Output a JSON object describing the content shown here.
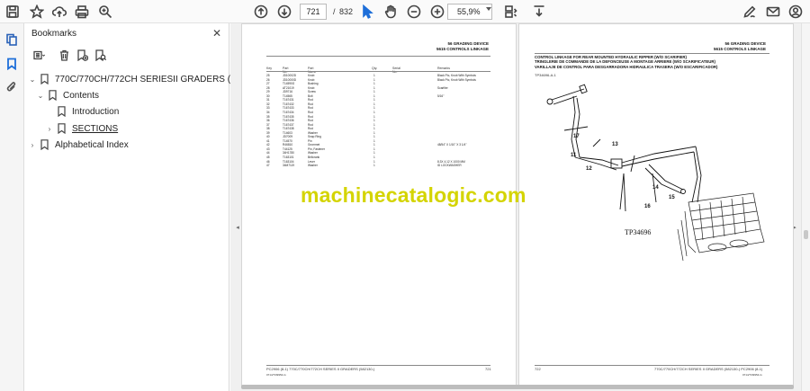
{
  "toolbar": {
    "page_current": "721",
    "page_separator": "/",
    "page_total": "832",
    "zoom": "55,9%"
  },
  "panel": {
    "title": "Bookmarks",
    "close_glyph": "✕"
  },
  "bookmarks": [
    {
      "label": "770C/770CH/772CH SERIESII GRADERS (582130-)",
      "chevron": "⌄"
    },
    {
      "label": "Contents",
      "chevron": "⌄"
    },
    {
      "label": "Introduction",
      "chevron": ""
    },
    {
      "label": "SECTIONS",
      "chevron": "›"
    },
    {
      "label": "Alphabetical Index",
      "chevron": "›"
    }
  ],
  "collapse": {
    "left": "◂",
    "right": "▸"
  },
  "watermark": "machinecatalogic.com",
  "left_page": {
    "header_line1": "56 GRADING DEVICE",
    "header_line2": "5615 CONTROLS LINKAGE",
    "footer_left": "PC2906   (8-1)     770C/770CH/772CH SERIES II GRADERS (582130-)",
    "footer_page": "721",
    "footer_code": "0714/7/09954-G",
    "rows": [
      {
        "no": "25",
        "part": "JD10002D",
        "desc": "Knob",
        "qty": "1",
        "notes": "Black Ptc, Knob With Symbols"
      },
      {
        "no": "26",
        "part": "JD10000D",
        "desc": "Knob",
        "qty": "1",
        "notes": "Black Ptc, Knob With Symbols"
      },
      {
        "no": "27",
        "part": "T14590G",
        "desc": "Bushing",
        "qty": "1",
        "notes": ""
      },
      {
        "no": "28",
        "part": "AT21019",
        "desc": "Knob",
        "qty": "1",
        "notes": "Scarifier"
      },
      {
        "no": "29",
        "part": "JD9716",
        "desc": "Screw",
        "qty": "1",
        "notes": ""
      },
      {
        "no": "30",
        "part": "T14565",
        "desc": "Bolt",
        "qty": "1",
        "notes": "5/16\""
      },
      {
        "no": "31",
        "part": "T167431",
        "desc": "Rod",
        "qty": "1",
        "notes": ""
      },
      {
        "no": "32",
        "part": "T167432",
        "desc": "Rod",
        "qty": "1",
        "notes": ""
      },
      {
        "no": "33",
        "part": "T167433",
        "desc": "Rod",
        "qty": "1",
        "notes": ""
      },
      {
        "no": "34",
        "part": "T167434",
        "desc": "Rod",
        "qty": "1",
        "notes": ""
      },
      {
        "no": "35",
        "part": "T167435",
        "desc": "Rod",
        "qty": "1",
        "notes": ""
      },
      {
        "no": "36",
        "part": "T167436",
        "desc": "Rod",
        "qty": "1",
        "notes": ""
      },
      {
        "no": "37",
        "part": "T167437",
        "desc": "Rod",
        "qty": "1",
        "notes": ""
      },
      {
        "no": "38",
        "part": "T167438",
        "desc": "Rod",
        "qty": "1",
        "notes": ""
      },
      {
        "no": "39",
        "part": "T14603",
        "desc": "Washer",
        "qty": "1",
        "notes": ""
      },
      {
        "no": "40",
        "part": "JD7009",
        "desc": "Snap Ring",
        "qty": "1",
        "notes": ""
      },
      {
        "no": "41",
        "part": "T14570",
        "desc": "Pin",
        "qty": "1",
        "notes": ""
      },
      {
        "no": "42",
        "part": "R46810",
        "desc": "Grommet",
        "qty": "1",
        "notes": "48/54\" X 1/10\" X 3 1/4\""
      },
      {
        "no": "43",
        "part": "T44125",
        "desc": "Pin, Fastener",
        "qty": "1",
        "notes": ""
      },
      {
        "no": "44",
        "part": "34H1780",
        "desc": "Washer",
        "qty": "1",
        "notes": ""
      },
      {
        "no": "45",
        "part": "T163101",
        "desc": "Bellcrank",
        "qty": "1",
        "notes": ""
      },
      {
        "no": "46",
        "part": "T163104",
        "desc": "Lever",
        "qty": "1",
        "notes": "8.3X 4.12 X 1000 MM"
      },
      {
        "no": "47",
        "part": "34M7119",
        "desc": "Washer",
        "qty": "1",
        "notes": "ID LOCKWASHER"
      }
    ],
    "table_head": {
      "no": "Key",
      "part": "Part No.",
      "desc": "Part Name",
      "qty": "Qty.",
      "serial": "Serial No.",
      "notes": "Remarks"
    }
  },
  "right_page": {
    "header_line1": "56 GRADING DEVICE",
    "header_line2": "5615 CONTROLS LINKAGE",
    "title_lines": [
      "CONTROL LINKAGE FOR REAR MOUNTED HYDRAULIC RIPPER (W/O SCARIFIER)",
      "TRINGLERIE DE COMMANDE DE LA DEFONCEUSE A MONTAGE ARRIERE (W/O SCARIFICATEUR)",
      "VARILLAJE DE CONTROL PARA DESGARRADORA HIDRAULICA TRASERA (W/O ESCARIFICADOR)"
    ],
    "figure_ref": "TP34696-A-1",
    "tp_label": "TP34696",
    "footer_page": "722",
    "footer_right": "770C/770CH/772CH SERIES II GRADERS (582130-)    PC2906   (8-1)",
    "footer_code": "0714/7/09954-G",
    "callouts": [
      "11",
      "12",
      "13",
      "14",
      "15",
      "16",
      "17"
    ]
  }
}
